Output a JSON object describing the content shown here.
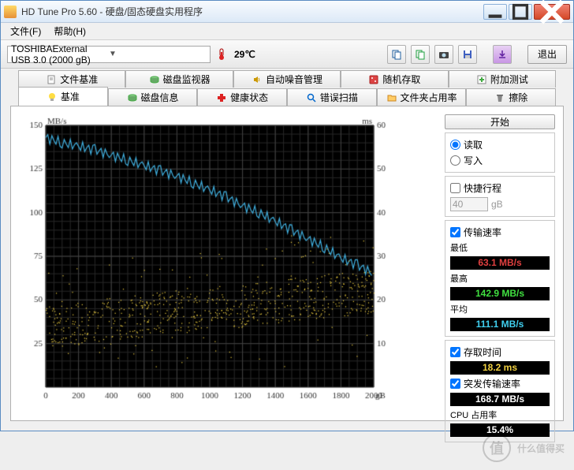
{
  "window": {
    "title": "HD Tune Pro 5.60 - 硬盘/固态硬盘实用程序"
  },
  "menu": {
    "file": "文件(F)",
    "help": "帮助(H)"
  },
  "toolbar": {
    "device": "TOSHIBAExternal USB 3.0 (2000 gB)",
    "temp": "29℃",
    "exit": "退出"
  },
  "tabs_top": [
    {
      "icon": "doc",
      "label": "文件基准"
    },
    {
      "icon": "disk",
      "label": "磁盘监视器"
    },
    {
      "icon": "speaker",
      "label": "自动噪音管理"
    },
    {
      "icon": "dice",
      "label": "随机存取"
    },
    {
      "icon": "plus",
      "label": "附加测试"
    }
  ],
  "tabs_bot": [
    {
      "icon": "bulb",
      "label": "基准",
      "active": true
    },
    {
      "icon": "disk",
      "label": "磁盘信息"
    },
    {
      "icon": "cross",
      "label": "健康状态"
    },
    {
      "icon": "search",
      "label": "错误扫描"
    },
    {
      "icon": "folder",
      "label": "文件夹占用率"
    },
    {
      "icon": "trash",
      "label": "擦除"
    }
  ],
  "chart_data": {
    "type": "line",
    "title": "",
    "xlabel": "",
    "ylabel_left": "MB/s",
    "ylabel_right": "ms",
    "xlim": [
      0,
      2000
    ],
    "ylim_left": [
      0,
      150
    ],
    "ylim_right": [
      0,
      60
    ],
    "xunit": "gB",
    "xticks": [
      0,
      200,
      400,
      600,
      800,
      1000,
      1200,
      1400,
      1600,
      1800,
      2000
    ],
    "yticks_left": [
      25,
      50,
      75,
      100,
      125,
      150
    ],
    "yticks_right": [
      10,
      20,
      30,
      40,
      50,
      60
    ],
    "series": [
      {
        "name": "transfer",
        "axis": "left",
        "color": "#40b0e0",
        "style": "line",
        "x": [
          0,
          100,
          200,
          300,
          400,
          500,
          600,
          700,
          800,
          900,
          1000,
          1100,
          1200,
          1300,
          1400,
          1500,
          1600,
          1700,
          1800,
          1900,
          2000
        ],
        "y": [
          143,
          140,
          138,
          136,
          133,
          130,
          127,
          124,
          121,
          117,
          113,
          109,
          104,
          100,
          95,
          90,
          85,
          80,
          74,
          70,
          65
        ]
      },
      {
        "name": "access",
        "axis": "right",
        "color": "#f0d040",
        "style": "scatter",
        "x": [
          0,
          100,
          200,
          300,
          400,
          500,
          600,
          700,
          800,
          900,
          1000,
          1100,
          1200,
          1300,
          1400,
          1500,
          1600,
          1700,
          1800,
          1900,
          2000
        ],
        "y": [
          14,
          15,
          16,
          17,
          17,
          18,
          18,
          18,
          18,
          18,
          19,
          19,
          19,
          19,
          20,
          20,
          20,
          21,
          21,
          21,
          22
        ]
      }
    ]
  },
  "side": {
    "start": "开始",
    "read": "读取",
    "write": "写入",
    "short": "快捷行程",
    "short_val": "40",
    "short_unit": "gB",
    "transfer": "传输速率",
    "min_l": "最低",
    "min_v": "63.1 MB/s",
    "max_l": "最高",
    "max_v": "142.9 MB/s",
    "avg_l": "平均",
    "avg_v": "111.1 MB/s",
    "access": "存取时间",
    "access_v": "18.2 ms",
    "burst": "突发传输速率",
    "burst_v": "168.7 MB/s",
    "cpu": "CPU 占用率",
    "cpu_v": "15.4%"
  },
  "watermark": "什么值得买"
}
